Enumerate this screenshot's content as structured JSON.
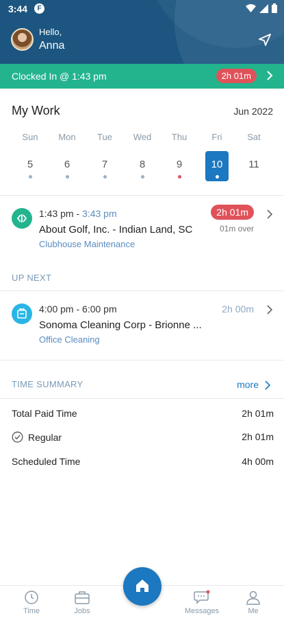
{
  "status_bar": {
    "time": "3:44",
    "app_badge": "F"
  },
  "header": {
    "greeting": "Hello,",
    "user_name": "Anna"
  },
  "clock_bar": {
    "text": "Clocked In @ 1:43 pm",
    "elapsed": "2h 01m"
  },
  "my_work": {
    "title": "My Work",
    "month": "Jun 2022",
    "days": [
      {
        "name": "Sun",
        "date": "5",
        "dot": "#9bb0c2"
      },
      {
        "name": "Mon",
        "date": "6",
        "dot": "#9bb0c2"
      },
      {
        "name": "Tue",
        "date": "7",
        "dot": "#9bb0c2"
      },
      {
        "name": "Wed",
        "date": "8",
        "dot": "#9bb0c2"
      },
      {
        "name": "Thu",
        "date": "9",
        "dot": "#e0525a"
      },
      {
        "name": "Fri",
        "date": "10",
        "dot": "#ffffff",
        "selected": true
      },
      {
        "name": "Sat",
        "date": "11",
        "dot": null
      }
    ]
  },
  "current_job": {
    "start": "1:43 pm - ",
    "end": "3:43 pm",
    "company": "About Golf, Inc. - Indian Land, SC",
    "type": "Clubhouse Maintenance",
    "badge": "2h 01m",
    "status": "01m over",
    "icon": "swap-arrows-icon",
    "icon_color": "#23b48e"
  },
  "up_next": {
    "label": "UP NEXT",
    "job": {
      "time": "4:00 pm - 6:00 pm",
      "company": "Sonoma Cleaning Corp - Brionne ...",
      "type": "Office Cleaning",
      "duration": "2h 00m",
      "icon": "building-icon",
      "icon_color": "#29b6e6"
    }
  },
  "time_summary": {
    "label": "TIME SUMMARY",
    "more": "more",
    "rows": [
      {
        "label": "Total Paid Time",
        "value": "2h 01m"
      },
      {
        "label": "Regular",
        "value": "2h 01m",
        "icon": "check-circle-icon"
      },
      {
        "label": "Scheduled Time",
        "value": "4h 00m"
      }
    ]
  },
  "bottom_nav": {
    "items": [
      {
        "label": "Time",
        "icon": "clock-icon"
      },
      {
        "label": "Jobs",
        "icon": "briefcase-icon"
      },
      {
        "label": "Messages",
        "icon": "chat-icon"
      },
      {
        "label": "Me",
        "icon": "person-icon"
      }
    ],
    "home_icon": "home-icon"
  },
  "colors": {
    "header": "#1c5680",
    "clock_bar": "#23b48e",
    "badge": "#e0525a",
    "accent": "#1c78c0"
  }
}
